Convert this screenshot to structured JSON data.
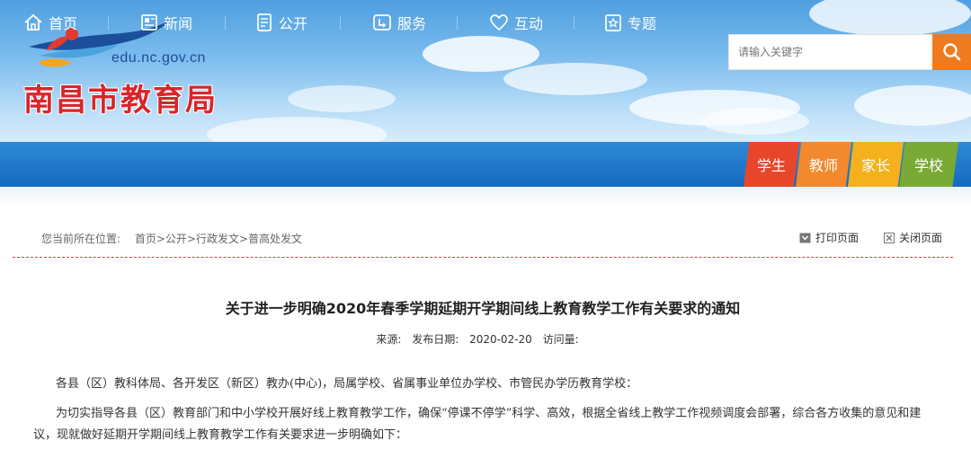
{
  "header": {
    "site_url": "edu.nc.gov.cn",
    "site_title": "南昌市教育局",
    "search_placeholder": "请输入关键字"
  },
  "nav": {
    "items": [
      {
        "label": "首页",
        "icon": "home-icon"
      },
      {
        "label": "新闻",
        "icon": "news-icon"
      },
      {
        "label": "公开",
        "icon": "document-icon"
      },
      {
        "label": "服务",
        "icon": "service-icon"
      },
      {
        "label": "互动",
        "icon": "heart-icon"
      },
      {
        "label": "专题",
        "icon": "topic-icon"
      }
    ],
    "roles": [
      {
        "label": "学生",
        "color": "#e8462b"
      },
      {
        "label": "教师",
        "color": "#f2892c"
      },
      {
        "label": "家长",
        "color": "#f4b11d"
      },
      {
        "label": "学校",
        "color": "#7aaa36"
      }
    ]
  },
  "breadcrumb": {
    "label": "您当前所在位置:",
    "path": "首页>公开>行政发文>普高处发文"
  },
  "tools": {
    "print": "打印页面",
    "close": "关闭页面"
  },
  "article": {
    "title": "关于进一步明确2020年春季学期延期开学期间线上教育教学工作有关要求的通知",
    "source_label": "来源:",
    "date_label": "发布日期:",
    "date": "2020-02-20",
    "views_label": "访问量:",
    "para1": "各县（区）教科体局、各开发区（新区）教办(中心)，局属学校、省属事业单位办学校、市管民办学历教育学校：",
    "para2_line1": "为切实指导各县（区）教育部门和中小学校开展好线上教育教学工作，确保“停课不停学”科学、高效，根据全省线上教学工作视频调度会部署，综合各方收集的意见和建",
    "para2_line2": "议，现就做好延期开学期间线上教育教学工作有关要求进一步明确如下："
  }
}
